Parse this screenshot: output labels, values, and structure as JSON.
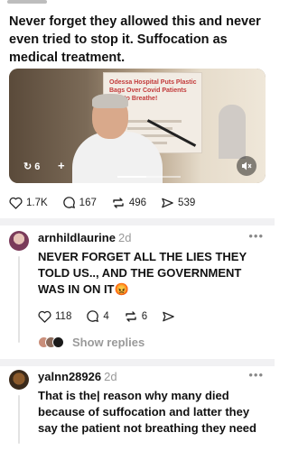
{
  "post": {
    "text": "Never forget they allowed this and never even tried to stop it. Suffocation as medical treatment.",
    "media": {
      "poster_text": "Odessa Hospital Puts Plastic Bags Over Covid Patients ...ng to Breathe!",
      "repost_count": "6",
      "plus_label": "+",
      "progress": 0.45
    },
    "actions": {
      "likes": "1.7K",
      "comments": "167",
      "reposts": "496",
      "shares": "539"
    }
  },
  "comments": [
    {
      "username": "arnhildlaurine",
      "time": "2d",
      "more": "•••",
      "text": "NEVER FORGET ALL THE LIES THEY TOLD US.., AND THE GOVERNMENT WAS IN ON IT😡",
      "likes": "118",
      "replies": "4",
      "reposts": "6",
      "show_replies": "Show replies"
    },
    {
      "username": "yalnn28926",
      "time": "2d",
      "more": "•••",
      "text": "That is the| reason why many died because of suffocation and latter they say the patient not breathing they need to"
    }
  ],
  "colors": {
    "divider": "#f1f1f3",
    "muted": "#9a9a9a",
    "text": "#111111"
  }
}
